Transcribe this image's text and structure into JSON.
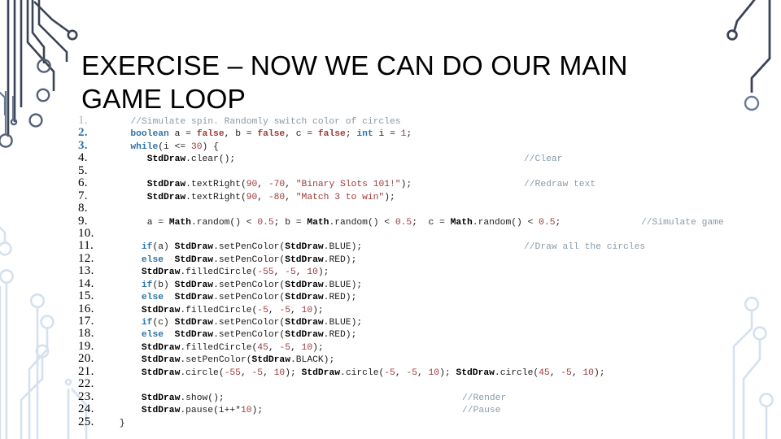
{
  "slide": {
    "title": "EXERCISE – NOW WE CAN DO OUR MAIN GAME LOOP",
    "background_color": "#ffffff"
  },
  "theme": {
    "keyword_color": "#2e74a8",
    "literal_color": "#a03a3a",
    "string_color": "#a03a3a",
    "number_color": "#a03a3a",
    "comment_color": "#8a9aa8",
    "class_color": "#000000",
    "plain_color": "#1c1c1c",
    "gutter_color": "#000000",
    "circuit_dark_color": "#3c4356",
    "circuit_mid_color": "#6b7a91",
    "circuit_light_color": "#dce5f2"
  },
  "code_block": {
    "language": "java",
    "gutter_suffix": ".",
    "first_line": 1,
    "last_line": 25,
    "lines": [
      {
        "n": "1.",
        "n_style": "gray",
        "text": "   //Simulate spin. Randomly switch color of circles",
        "comment": ""
      },
      {
        "n": "2.",
        "n_style": "blue",
        "text": "   boolean a = false, b = false, c = false; int i = 1;",
        "comment": ""
      },
      {
        "n": "3.",
        "n_style": "blue",
        "text": "   while(i <= 30) {",
        "comment": ""
      },
      {
        "n": "4.",
        "n_style": "plain",
        "text": "      StdDraw.clear();",
        "comment": "//Clear"
      },
      {
        "n": "5.",
        "n_style": "plain",
        "text": "",
        "comment": ""
      },
      {
        "n": "6.",
        "n_style": "plain",
        "text": "      StdDraw.textRight(90, -70, \"Binary Slots 101!\");",
        "comment": "//Redraw text"
      },
      {
        "n": "7.",
        "n_style": "plain",
        "text": "      StdDraw.textRight(90, -80, \"Match 3 to win\");",
        "comment": ""
      },
      {
        "n": "8.",
        "n_style": "plain",
        "text": "",
        "comment": ""
      },
      {
        "n": "9.",
        "n_style": "plain",
        "text": "      a = Math.random() < 0.5; b = Math.random() < 0.5;  c = Math.random() < 0.5;",
        "comment": "//Simulate game"
      },
      {
        "n": "10.",
        "n_style": "plain",
        "text": "",
        "comment": ""
      },
      {
        "n": "11.",
        "n_style": "plain",
        "text": "     if(a) StdDraw.setPenColor(StdDraw.BLUE);",
        "comment": "//Draw all the circles"
      },
      {
        "n": "12.",
        "n_style": "plain",
        "text": "     else  StdDraw.setPenColor(StdDraw.RED);",
        "comment": ""
      },
      {
        "n": "13.",
        "n_style": "plain",
        "text": "     StdDraw.filledCircle(-55, -5, 10);",
        "comment": ""
      },
      {
        "n": "14.",
        "n_style": "plain",
        "text": "     if(b) StdDraw.setPenColor(StdDraw.BLUE);",
        "comment": ""
      },
      {
        "n": "15.",
        "n_style": "plain",
        "text": "     else  StdDraw.setPenColor(StdDraw.RED);",
        "comment": ""
      },
      {
        "n": "16.",
        "n_style": "plain",
        "text": "     StdDraw.filledCircle(-5, -5, 10);",
        "comment": ""
      },
      {
        "n": "17.",
        "n_style": "plain",
        "text": "     if(c) StdDraw.setPenColor(StdDraw.BLUE);",
        "comment": ""
      },
      {
        "n": "18.",
        "n_style": "plain",
        "text": "     else  StdDraw.setPenColor(StdDraw.RED);",
        "comment": ""
      },
      {
        "n": "19.",
        "n_style": "plain",
        "text": "     StdDraw.filledCircle(45, -5, 10);",
        "comment": ""
      },
      {
        "n": "20.",
        "n_style": "plain",
        "text": "     StdDraw.setPenColor(StdDraw.BLACK);",
        "comment": ""
      },
      {
        "n": "21.",
        "n_style": "plain",
        "text": "     StdDraw.circle(-55, -5, 10); StdDraw.circle(-5, -5, 10); StdDraw.circle(45, -5, 10);",
        "comment": ""
      },
      {
        "n": "22.",
        "n_style": "plain",
        "text": "",
        "comment": ""
      },
      {
        "n": "23.",
        "n_style": "plain",
        "text": "     StdDraw.show();",
        "comment": "//Render"
      },
      {
        "n": "24.",
        "n_style": "plain",
        "text": "     StdDraw.pause(i++*10);",
        "comment": "//Pause"
      },
      {
        "n": "25.",
        "n_style": "plain",
        "text": " }",
        "comment": ""
      }
    ],
    "comment_column_offsets": {
      "clear": 504,
      "redraw_text": 504,
      "simulate_game": 648,
      "draw_circles": 504,
      "render": 428,
      "pause": 428
    }
  },
  "decor": {
    "left_artwork_name": "circuit-board-traces-left",
    "right_artwork_name": "circuit-board-traces-right"
  }
}
